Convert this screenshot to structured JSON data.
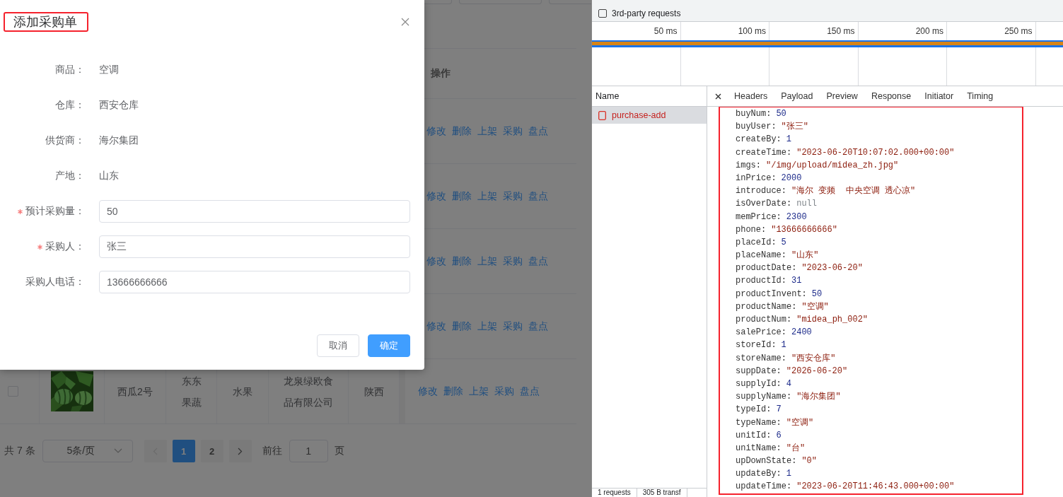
{
  "dialog": {
    "title": "添加采购单",
    "title_highlighted": true,
    "fields": [
      {
        "kind": "text",
        "label": "商品：",
        "value": "空调",
        "required": false
      },
      {
        "kind": "text",
        "label": "仓库：",
        "value": "西安仓库",
        "required": false
      },
      {
        "kind": "text",
        "label": "供货商：",
        "value": "海尔集团",
        "required": false
      },
      {
        "kind": "text",
        "label": "产地：",
        "value": "山东",
        "required": false
      },
      {
        "kind": "input",
        "label": "预计采购量：",
        "value": "50",
        "required": true
      },
      {
        "kind": "input",
        "label": "采购人：",
        "value": "张三",
        "required": true
      },
      {
        "kind": "input",
        "label": "采购人电话：",
        "value": "13666666666",
        "required": false
      }
    ],
    "buttons": [
      {
        "label": "取消",
        "kind": "default"
      },
      {
        "label": "确定",
        "kind": "primary"
      }
    ]
  },
  "table": {
    "action_column_label": "操作",
    "rows": [
      {
        "actions": [
          "修改",
          "删除",
          "上架",
          "采购",
          "盘点"
        ]
      },
      {
        "actions": [
          "修改",
          "删除",
          "上架",
          "采购",
          "盘点"
        ]
      },
      {
        "actions": [
          "修改",
          "删除",
          "上架",
          "采购",
          "盘点"
        ]
      },
      {
        "actions": [
          "修改",
          "删除",
          "上架",
          "采购",
          "盘点"
        ]
      },
      {
        "checked": false,
        "image": {
          "kind": "picture"
        },
        "cells": [
          "西瓜2号",
          "东东果蔬",
          "水果",
          "龙泉绿欧食品有限公司",
          "陕西"
        ],
        "actions": [
          "修改",
          "删除",
          "上架",
          "采购",
          "盘点"
        ]
      }
    ]
  },
  "pagination": {
    "total": "共 7 条",
    "page_size": "5条/页",
    "pages": [
      {
        "label": "1",
        "selected": true
      },
      {
        "label": "2",
        "selected": false
      }
    ],
    "goto_label": "前往",
    "goto_value": "1",
    "page_suffix": "页"
  },
  "devtools": {
    "filters": [
      {
        "label": "3rd-party requests",
        "checked": false
      }
    ],
    "timeline": {
      "ticks": [
        "50 ms",
        "100 ms",
        "150 ms",
        "200 ms",
        "250 ms"
      ]
    },
    "requests": {
      "column": "Name",
      "items": [
        {
          "name": "purchase-add",
          "selected": true
        }
      ]
    },
    "detail_tabs": [
      "Headers",
      "Payload",
      "Preview",
      "Response",
      "Initiator",
      "Timing"
    ],
    "payload": {
      "highlighted": true,
      "entries": [
        {
          "key": "buyNum:",
          "value": "50",
          "kind": "number"
        },
        {
          "key": "buyUser:",
          "value": "\"张三\"",
          "kind": "string"
        },
        {
          "key": "createBy:",
          "value": "1",
          "kind": "number"
        },
        {
          "key": "createTime:",
          "value": "\"2023-06-20T10:07:02.000+00:00\"",
          "kind": "string"
        },
        {
          "key": "imgs:",
          "value": "\"/img/upload/midea_zh.jpg\"",
          "kind": "string"
        },
        {
          "key": "inPrice:",
          "value": "2000",
          "kind": "number"
        },
        {
          "key": "introduce:",
          "value": "\"海尔 变频  中央空调 透心凉\"",
          "kind": "string"
        },
        {
          "key": "isOverDate:",
          "value": "null",
          "kind": "null"
        },
        {
          "key": "memPrice:",
          "value": "2300",
          "kind": "number"
        },
        {
          "key": "phone:",
          "value": "\"13666666666\"",
          "kind": "string"
        },
        {
          "key": "placeId:",
          "value": "5",
          "kind": "number"
        },
        {
          "key": "placeName:",
          "value": "\"山东\"",
          "kind": "string"
        },
        {
          "key": "productDate:",
          "value": "\"2023-06-20\"",
          "kind": "string"
        },
        {
          "key": "productId:",
          "value": "31",
          "kind": "number"
        },
        {
          "key": "productInvent:",
          "value": "50",
          "kind": "number"
        },
        {
          "key": "productName:",
          "value": "\"空调\"",
          "kind": "string"
        },
        {
          "key": "productNum:",
          "value": "\"midea_ph_002\"",
          "kind": "string"
        },
        {
          "key": "salePrice:",
          "value": "2400",
          "kind": "number"
        },
        {
          "key": "storeId:",
          "value": "1",
          "kind": "number"
        },
        {
          "key": "storeName:",
          "value": "\"西安仓库\"",
          "kind": "string"
        },
        {
          "key": "suppDate:",
          "value": "\"2026-06-20\"",
          "kind": "string"
        },
        {
          "key": "supplyId:",
          "value": "4",
          "kind": "number"
        },
        {
          "key": "supplyName:",
          "value": "\"海尔集团\"",
          "kind": "string"
        },
        {
          "key": "typeId:",
          "value": "7",
          "kind": "number"
        },
        {
          "key": "typeName:",
          "value": "\"空调\"",
          "kind": "string"
        },
        {
          "key": "unitId:",
          "value": "6",
          "kind": "number"
        },
        {
          "key": "unitName:",
          "value": "\"台\"",
          "kind": "string"
        },
        {
          "key": "upDownState:",
          "value": "\"0\"",
          "kind": "string"
        },
        {
          "key": "updateBy:",
          "value": "1",
          "kind": "number"
        },
        {
          "key": "updateTime:",
          "value": "\"2023-06-20T11:46:43.000+00:00\"",
          "kind": "string"
        }
      ]
    },
    "status_bar": [
      "1 requests",
      "305 B transf"
    ]
  }
}
